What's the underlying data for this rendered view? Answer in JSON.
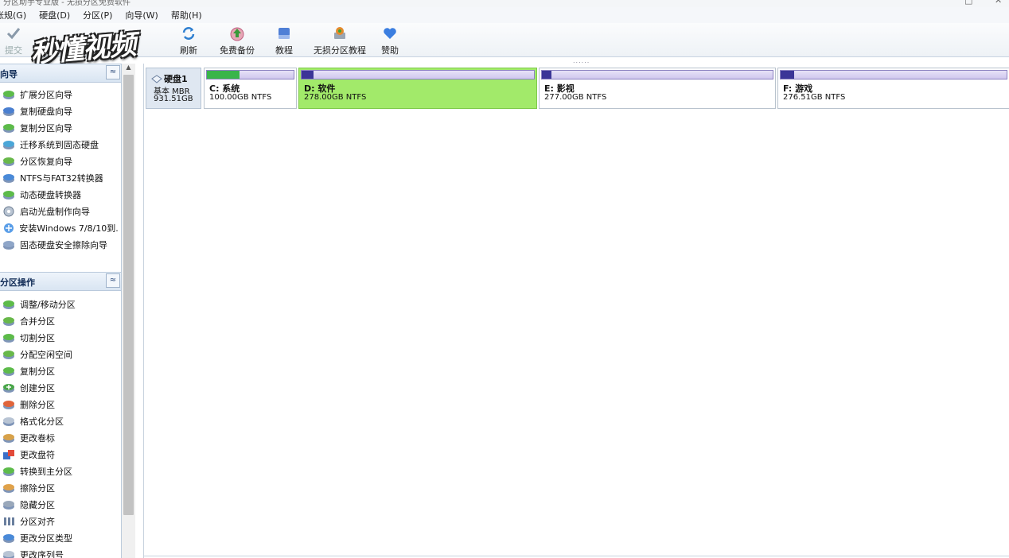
{
  "window": {
    "title": "分区助手专业版 - 无损分区免费软件",
    "minimize": "□",
    "close": "✕"
  },
  "menu": [
    {
      "label": "帐规(G)"
    },
    {
      "label": "硬盘(D)"
    },
    {
      "label": "分区(P)"
    },
    {
      "label": "向导(W)"
    },
    {
      "label": "帮助(H)"
    }
  ],
  "toolbar": {
    "commit": "提交",
    "refresh": "刷新",
    "free_backup": "免费备份",
    "tutorial": "教程",
    "lossless_tutorial": "无损分区教程",
    "donate": "赞助"
  },
  "watermark": "秒懂视频",
  "grip": "......",
  "wizard_section": {
    "title": "向导",
    "collapse": "≈",
    "items": [
      {
        "label": "扩展分区向导",
        "icon": "extend-wizard-icon"
      },
      {
        "label": "复制硬盘向导",
        "icon": "copy-disk-icon"
      },
      {
        "label": "复制分区向导",
        "icon": "copy-partition-icon"
      },
      {
        "label": "迁移系统到固态硬盘",
        "icon": "migrate-os-icon"
      },
      {
        "label": "分区恢复向导",
        "icon": "recovery-icon"
      },
      {
        "label": "NTFS与FAT32转换器",
        "icon": "converter-icon"
      },
      {
        "label": "动态硬盘转换器",
        "icon": "dynamic-disk-icon"
      },
      {
        "label": "启动光盘制作向导",
        "icon": "boot-disc-icon"
      },
      {
        "label": "安装Windows 7/8/10到...",
        "icon": "windows-install-icon"
      },
      {
        "label": "固态硬盘安全擦除向导",
        "icon": "ssd-erase-icon"
      }
    ]
  },
  "operations_section": {
    "title": "分区操作",
    "collapse": "≈",
    "items": [
      {
        "label": "调整/移动分区",
        "icon": "resize-icon"
      },
      {
        "label": "合并分区",
        "icon": "merge-icon"
      },
      {
        "label": "切割分区",
        "icon": "split-icon"
      },
      {
        "label": "分配空闲空间",
        "icon": "allocate-icon"
      },
      {
        "label": "复制分区",
        "icon": "copy-icon"
      },
      {
        "label": "创建分区",
        "icon": "create-icon"
      },
      {
        "label": "删除分区",
        "icon": "delete-icon"
      },
      {
        "label": "格式化分区",
        "icon": "format-icon"
      },
      {
        "label": "更改卷标",
        "icon": "label-icon"
      },
      {
        "label": "更改盘符",
        "icon": "drive-letter-icon"
      },
      {
        "label": "转换到主分区",
        "icon": "convert-primary-icon"
      },
      {
        "label": "擦除分区",
        "icon": "wipe-icon"
      },
      {
        "label": "隐藏分区",
        "icon": "hide-icon"
      },
      {
        "label": "分区对齐",
        "icon": "align-icon"
      },
      {
        "label": "更改分区类型",
        "icon": "type-icon"
      },
      {
        "label": "更改序列号",
        "icon": "serial-icon"
      }
    ]
  },
  "scroll": {
    "up": "▲"
  },
  "disk": {
    "name": "硬盘1",
    "type": "基本 MBR",
    "size": "931.51GB",
    "partitions": [
      {
        "name": "C: 系统",
        "size": "100.00GB NTFS",
        "used": 0.38,
        "color": "#39b54a",
        "selected": false
      },
      {
        "name": "D: 软件",
        "size": "278.00GB NTFS",
        "used": 0.05,
        "color": "#3b3597",
        "selected": true
      },
      {
        "name": "E: 影视",
        "size": "277.00GB NTFS",
        "used": 0.04,
        "color": "#3b3597",
        "selected": false
      },
      {
        "name": "F: 游戏",
        "size": "276.51GB NTFS",
        "used": 0.06,
        "color": "#3b3597",
        "selected": false
      }
    ]
  }
}
